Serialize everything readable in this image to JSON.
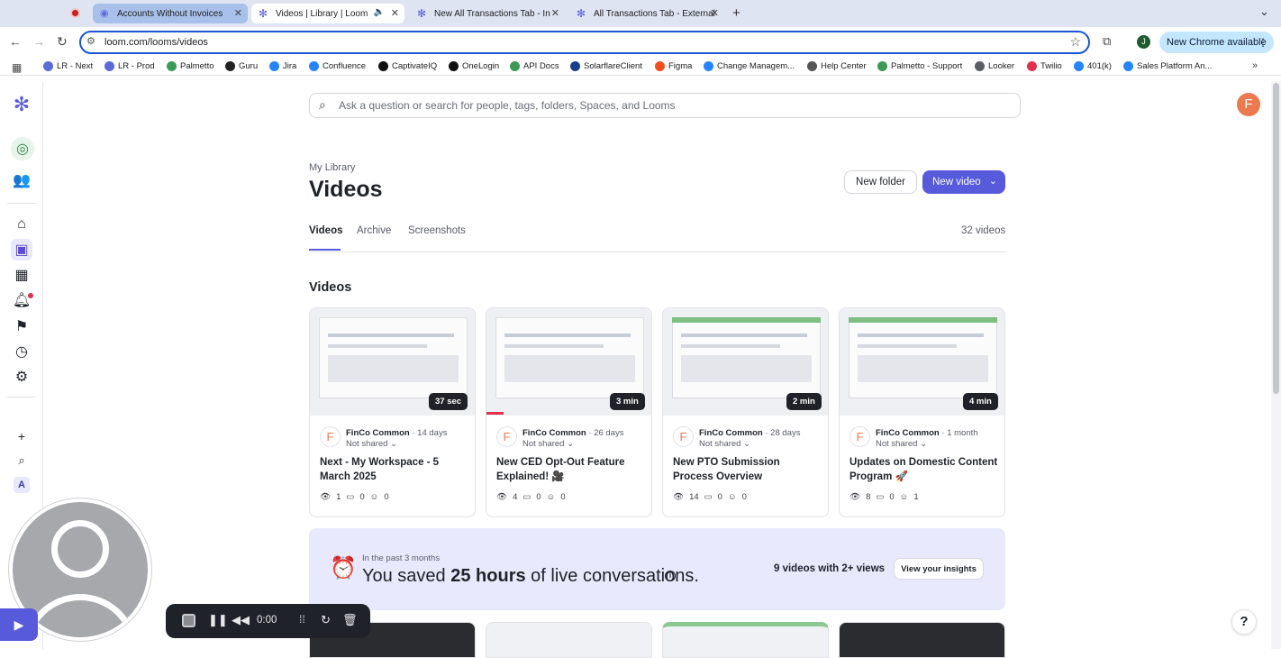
{
  "browser": {
    "tabs": [
      {
        "title": "Accounts Without Invoices",
        "state": "highlighted"
      },
      {
        "title": "Videos | Library | Loom",
        "state": "active"
      },
      {
        "title": "New All Transactions Tab - In",
        "state": "inactive"
      },
      {
        "title": "All Transactions Tab - External",
        "state": "inactive"
      }
    ],
    "url": "loom.com/looms/videos",
    "profile_initial": "J",
    "update_label": "New Chrome available",
    "bookmarks": [
      {
        "label": "LR - Next",
        "icon": "loom-icon",
        "color": "#5d6bd8"
      },
      {
        "label": "LR - Prod",
        "icon": "loom-icon",
        "color": "#5d6bd8"
      },
      {
        "label": "Palmetto",
        "icon": "palmetto-icon",
        "color": "#3c9a54"
      },
      {
        "label": "Guru",
        "icon": "guru-icon",
        "color": "#222222"
      },
      {
        "label": "Jira",
        "icon": "jira-icon",
        "color": "#2684ff"
      },
      {
        "label": "Confluence",
        "icon": "confluence-icon",
        "color": "#2684ff"
      },
      {
        "label": "CaptivateIQ",
        "icon": "captivateiq-icon",
        "color": "#111111"
      },
      {
        "label": "OneLogin",
        "icon": "onelogin-icon",
        "color": "#111111"
      },
      {
        "label": "API Docs",
        "icon": "api-docs-icon",
        "color": "#3c9a54"
      },
      {
        "label": "SolarflareClient",
        "icon": "solarflare-icon",
        "color": "#1a3f8f"
      },
      {
        "label": "Figma",
        "icon": "figma-icon",
        "color": "#f24e1e"
      },
      {
        "label": "Change Managem...",
        "icon": "change-mgmt-icon",
        "color": "#2684ff"
      },
      {
        "label": "Help Center",
        "icon": "help-center-icon",
        "color": "#555555"
      },
      {
        "label": "Palmetto - Support",
        "icon": "palmetto-icon",
        "color": "#3c9a54"
      },
      {
        "label": "Looker",
        "icon": "looker-icon",
        "color": "#5a5d66"
      },
      {
        "label": "Twilio",
        "icon": "twilio-icon",
        "color": "#e0304e"
      },
      {
        "label": "401(k)",
        "icon": "401k-icon",
        "color": "#2684ff"
      },
      {
        "label": "Sales Platform An...",
        "icon": "sales-platform-icon",
        "color": "#2684ff"
      }
    ]
  },
  "app": {
    "search_placeholder": "Ask a question or search for people, tags, folders, Spaces, and Looms",
    "avatar_initial": "F",
    "workspace_initial": "A",
    "breadcrumb": "My Library",
    "page_title": "Videos",
    "new_folder_label": "New folder",
    "new_video_label": "New video",
    "tabs": [
      "Videos",
      "Archive",
      "Screenshots"
    ],
    "video_count": "32 videos",
    "section_title": "Videos",
    "accent": "#565adb",
    "videos": [
      {
        "duration": "37 sec",
        "owner": "FinCo Common",
        "ago": "14 days",
        "sharing": "Not shared",
        "title": "Next - My Workspace - 5 March 2025",
        "views": "1",
        "comments": "0",
        "reactions": "0",
        "progress": 0
      },
      {
        "duration": "3 min",
        "owner": "FinCo Common",
        "ago": "26 days",
        "sharing": "Not shared",
        "title": "New CED Opt-Out Feature Explained! 🎥",
        "views": "4",
        "comments": "0",
        "reactions": "0",
        "progress": 0.1
      },
      {
        "duration": "2 min",
        "owner": "FinCo Common",
        "ago": "28 days",
        "sharing": "Not shared",
        "title": "New PTO Submission Process Overview",
        "views": "14",
        "comments": "0",
        "reactions": "0",
        "progress": 0
      },
      {
        "duration": "4 min",
        "owner": "FinCo Common",
        "ago": "1 month",
        "sharing": "Not shared",
        "title": "Updates on Domestic Content Program 🚀",
        "views": "8",
        "comments": "0",
        "reactions": "1",
        "progress": 0
      }
    ],
    "owner_initial": "F",
    "insights": {
      "period": "In the past 3 months",
      "prefix": "You saved",
      "hours": "25 hours",
      "suffix": "of live conversations.",
      "views_stat": "9 videos with 2+ views",
      "button": "View your insights"
    },
    "help": "?"
  },
  "recorder": {
    "time": "0:00"
  }
}
